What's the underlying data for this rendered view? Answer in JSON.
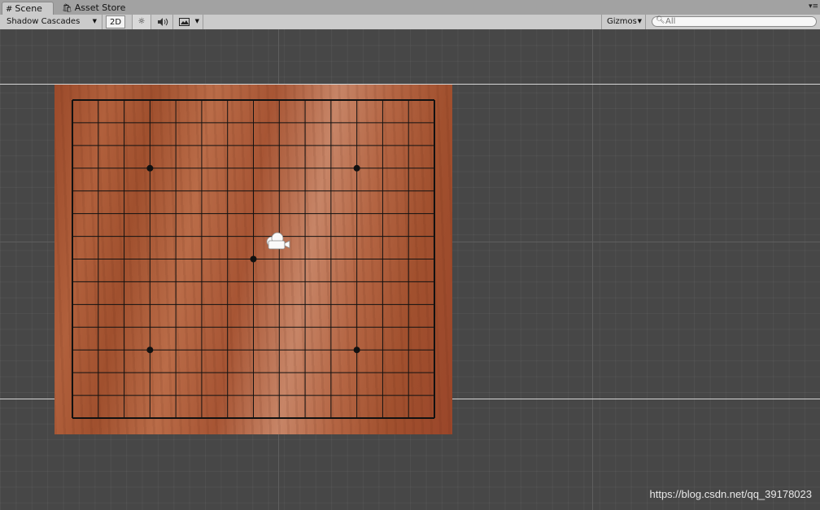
{
  "tabs": {
    "scene_label": "Scene",
    "asset_store_label": "Asset Store",
    "scene_icon": "grid-icon",
    "asset_store_icon": "shopping-bag-icon"
  },
  "toolbar": {
    "shadow_cascades_label": "Shadow Cascades",
    "mode_2d_label": "2D",
    "gizmos_label": "Gizmos",
    "search_placeholder": "All",
    "lighting_icon": "sun-icon",
    "audio_icon": "speaker-icon",
    "effects_icon": "image-icon"
  },
  "board": {
    "grid_lines": 15,
    "star_points": [
      [
        3,
        3
      ],
      [
        11,
        3
      ],
      [
        7,
        7
      ],
      [
        3,
        11
      ],
      [
        11,
        11
      ]
    ],
    "line_color": "#111111",
    "wood_color": "#b05e3b"
  },
  "watermark": "https://blog.csdn.net/qq_39178023"
}
